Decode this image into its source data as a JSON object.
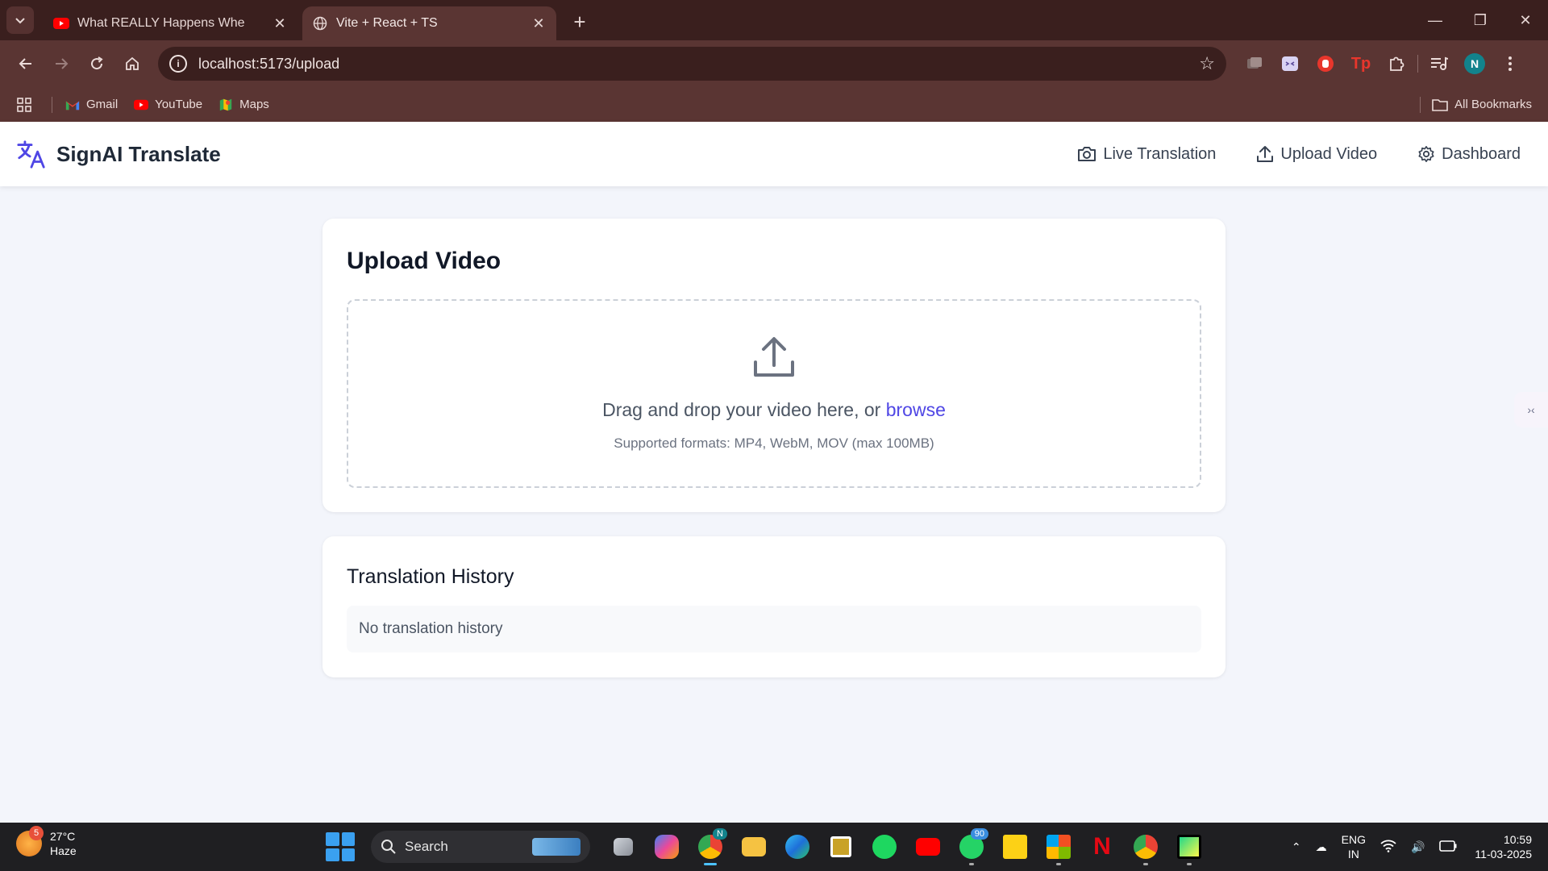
{
  "browser": {
    "tabs": [
      {
        "title": "What REALLY Happens Whe",
        "favicon": "youtube-icon",
        "active": false
      },
      {
        "title": "Vite + React + TS",
        "favicon": "globe-icon",
        "active": true
      }
    ],
    "url": "localhost:5173/upload",
    "bookmarks": [
      {
        "label": "Gmail",
        "icon": "gmail-icon"
      },
      {
        "label": "YouTube",
        "icon": "youtube-icon"
      },
      {
        "label": "Maps",
        "icon": "maps-icon"
      }
    ],
    "all_bookmarks": "All Bookmarks",
    "profile_initial": "N"
  },
  "app": {
    "brand": "SignAI Translate",
    "nav": {
      "live": "Live Translation",
      "upload": "Upload Video",
      "dashboard": "Dashboard"
    },
    "upload_card": {
      "title": "Upload Video",
      "drop_text": "Drag and drop your video here, or",
      "browse": "browse",
      "formats": "Supported formats: MP4, WebM, MOV (max 100MB)"
    },
    "history_card": {
      "title": "Translation History",
      "empty": "No translation history"
    },
    "accent_color": "#4f46e5"
  },
  "taskbar": {
    "weather": {
      "temp": "27°C",
      "condition": "Haze",
      "badge": "5"
    },
    "search_placeholder": "Search",
    "chrome_badge": "N",
    "whatsapp_badge": "90",
    "lang_top": "ENG",
    "lang_bottom": "IN",
    "time": "10:59",
    "date": "11-03-2025"
  }
}
